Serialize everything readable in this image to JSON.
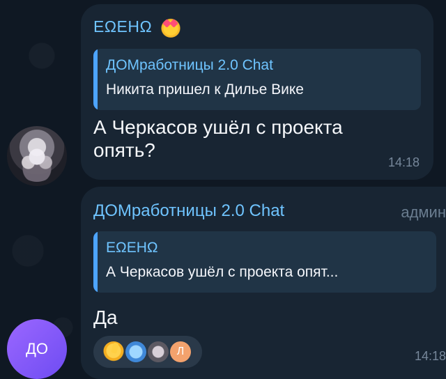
{
  "messages": [
    {
      "sender": "ЕΩЕНΩ",
      "reply": {
        "title": "ДОМработницы 2.0 Chat",
        "text": "Никита пришел к Дилье Вике"
      },
      "text": "А Черкасов ушёл с проекта опять?",
      "time": "14:18"
    },
    {
      "sender": "ДОМработницы 2.0 Chat",
      "role": "админ",
      "reply": {
        "title": "ЕΩЕНΩ",
        "text": "А Черкасов ушёл с проекта опят..."
      },
      "text": "Да",
      "time": "14:18",
      "reactions": {
        "items": [
          "thumbs-up-icon",
          "sticker-icon",
          "avatar-reaction-icon",
          "letter-badge-icon"
        ],
        "letter_badge": "Л"
      }
    }
  ],
  "avatars": {
    "second_avatar_text": "ДО"
  }
}
